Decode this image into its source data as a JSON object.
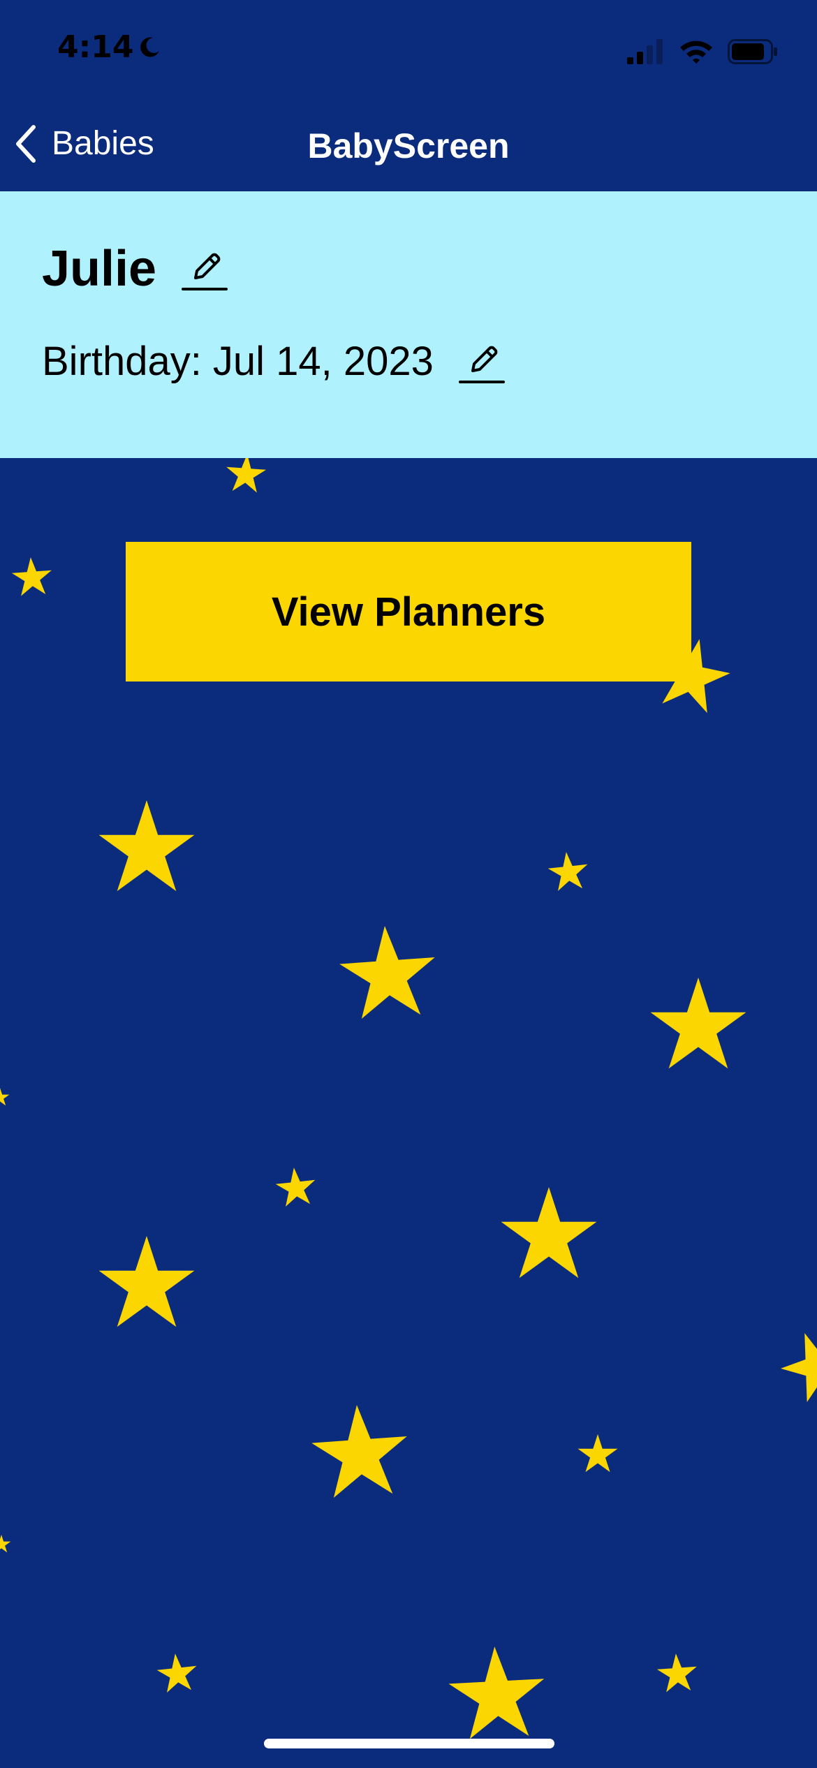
{
  "status_bar": {
    "time": "4:14",
    "icons": [
      "moon-icon",
      "cellular-signal-icon",
      "wifi-icon",
      "battery-icon"
    ]
  },
  "nav": {
    "back_label": "Babies",
    "title": "BabyScreen"
  },
  "baby": {
    "name": "Julie",
    "birthday_label": "Birthday:",
    "birthday_value": "Jul 14, 2023"
  },
  "actions": {
    "view_planners_label": "View Planners"
  },
  "theme": {
    "background": "#0b2b7d",
    "card": "#aff1fd",
    "accent": "#fcd600",
    "star": "#fcd600"
  }
}
